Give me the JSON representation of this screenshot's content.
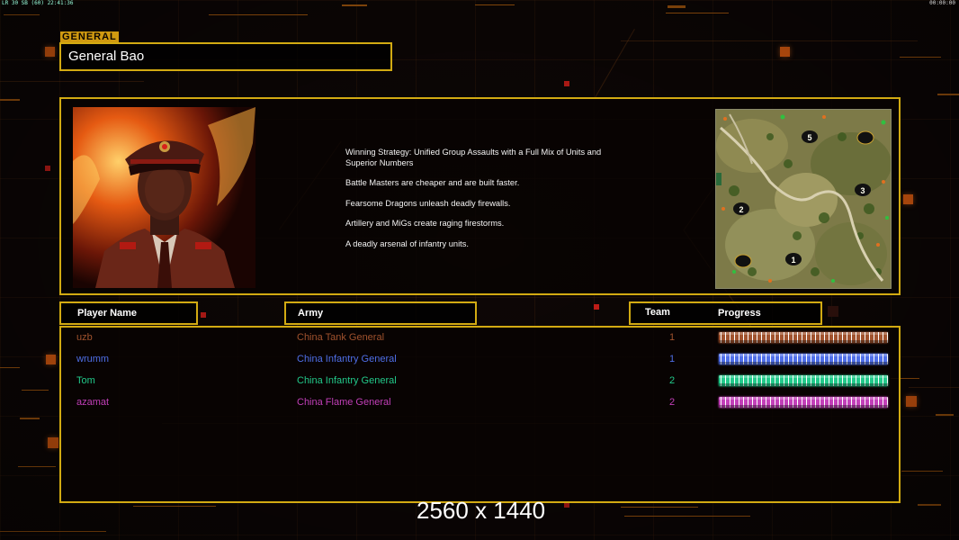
{
  "topbar": {
    "left": "LR 30 SB (60) 22:41:36",
    "right": "00:00:00"
  },
  "general_label": "GENERAL",
  "general_name": "General Bao",
  "strategy": [
    "Winning Strategy: Unified Group Assaults with a Full Mix of Units and\n Superior Numbers",
    "Battle Masters are cheaper and are built faster.",
    "Fearsome Dragons unleash deadly firewalls.",
    "Artillery and MiGs create raging firestorms.",
    "A deadly arsenal of infantry units."
  ],
  "minimap": {
    "markers": [
      "5",
      "3",
      "2",
      "1"
    ]
  },
  "headers": {
    "player_name": "Player Name",
    "army": "Army",
    "team": "Team",
    "progress": "Progress"
  },
  "players": [
    {
      "name": "uzb",
      "army": "China Tank General",
      "team": "1",
      "color": "#a0522d",
      "progress": 1.0
    },
    {
      "name": "wrumm",
      "army": "China Infantry General",
      "team": "1",
      "color": "#4f6fe8",
      "progress": 1.0
    },
    {
      "name": "Tom",
      "army": "China Infantry General",
      "team": "2",
      "color": "#22c98a",
      "progress": 1.0
    },
    {
      "name": "azamat",
      "army": "China Flame General",
      "team": "2",
      "color": "#c23fb8",
      "progress": 1.0
    }
  ],
  "resolution_label": "2560 x 1440",
  "colors": {
    "frame": "#d2aa12",
    "accent": "#ff6a12"
  }
}
